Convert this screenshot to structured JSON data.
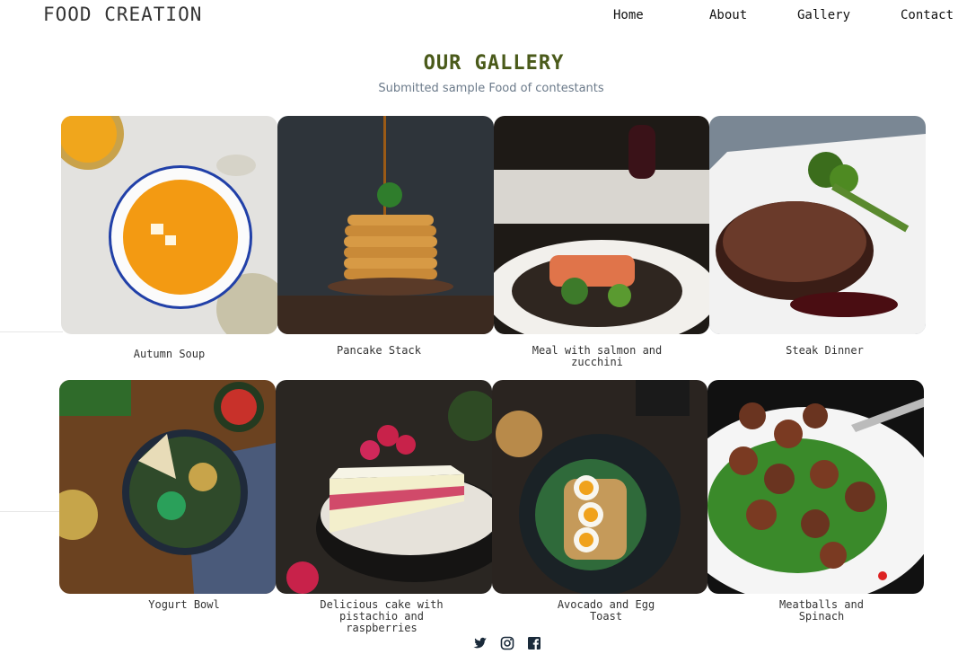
{
  "brand": "FOOD CREATION",
  "nav": [
    "Home",
    "About",
    "Gallery",
    "Contact"
  ],
  "gallery": {
    "title": "OUR GALLERY",
    "subtitle": "Submitted sample Food of contestants",
    "items": [
      {
        "caption": "Autumn Soup"
      },
      {
        "caption": "Pancake Stack"
      },
      {
        "caption": "Meal with salmon and zucchini"
      },
      {
        "caption": "Steak Dinner"
      },
      {
        "caption": "Yogurt Bowl"
      },
      {
        "caption": "Delicious cake with pistachio and raspberries"
      },
      {
        "caption": "Avocado and Egg Toast"
      },
      {
        "caption": "Meatballs and Spinach"
      }
    ]
  },
  "social": [
    "twitter-icon",
    "instagram-icon",
    "facebook-icon"
  ],
  "colors": {
    "title": "#4a5a1a",
    "subtitle": "#6b7a8a"
  }
}
